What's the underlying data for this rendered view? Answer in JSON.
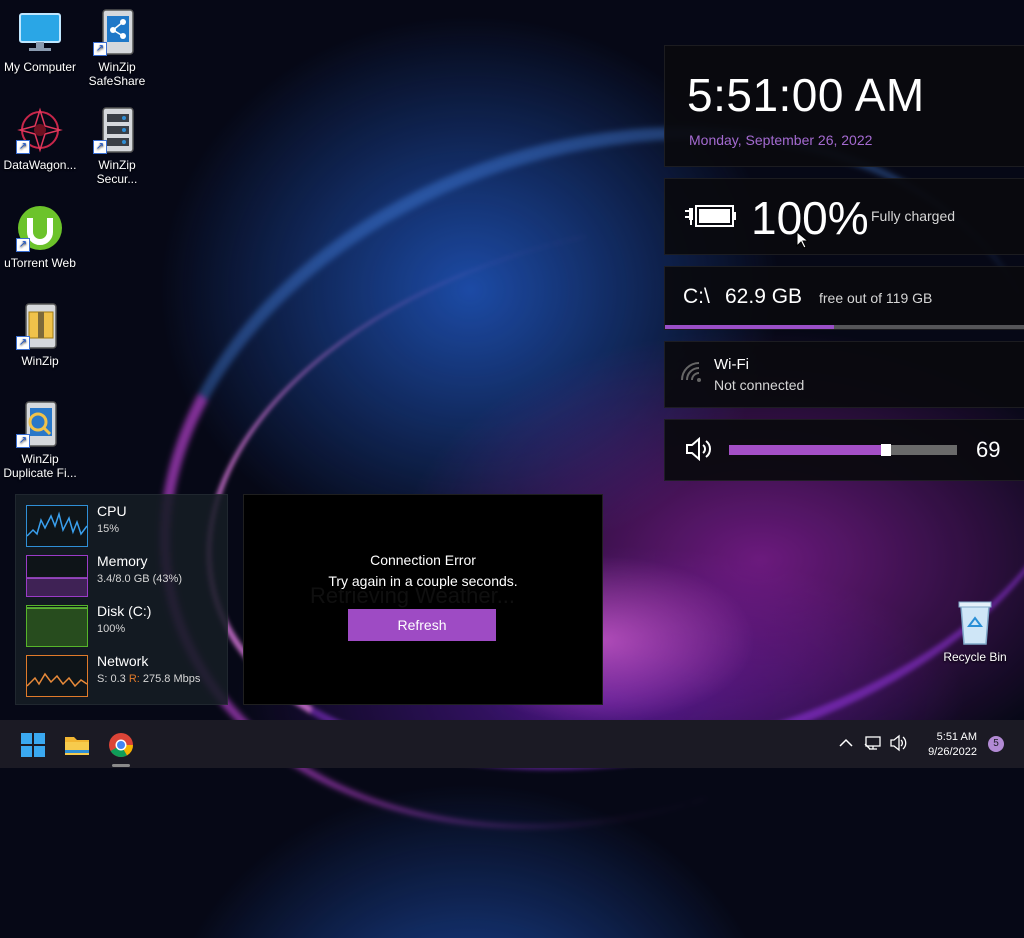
{
  "desktop_icons": {
    "my_computer": "My Computer",
    "safeshare": "WinZip SafeShare",
    "datawagon": "DataWagon...",
    "secure": "WinZip Secur...",
    "utorrent": "uTorrent Web",
    "winzip": "WinZip",
    "duplicate": "WinZip Duplicate Fi...",
    "recycle_bin": "Recycle Bin"
  },
  "clock": {
    "time": "5:51:00 AM",
    "date": "Monday, September 26, 2022"
  },
  "battery": {
    "percent_text": "100%",
    "status": "Fully charged"
  },
  "disk": {
    "drive": "C:\\",
    "free": "62.9 GB",
    "total_text": "free out of 119 GB",
    "used_fraction": 0.47
  },
  "wifi": {
    "name": "Wi-Fi",
    "status": "Not connected"
  },
  "volume": {
    "value": 69
  },
  "performance": {
    "cpu": {
      "name": "CPU",
      "value": "15%",
      "color": "#2f8fd6"
    },
    "memory": {
      "name": "Memory",
      "value": "3.4/8.0 GB (43%)",
      "color": "#9b3bc8"
    },
    "disk": {
      "name": "Disk (C:)",
      "value": "100%",
      "color": "#56b52a"
    },
    "network": {
      "name": "Network",
      "send_label": "S: 0.3",
      "recv_label": "R:",
      "recv_value": "275.8 Mbps",
      "color": "#e07a2a"
    }
  },
  "weather": {
    "ghost_text": "Retrieving Weather...",
    "error_title": "Connection Error",
    "error_message": "Try again in a couple seconds.",
    "refresh_label": "Refresh"
  },
  "taskbar": {
    "time": "5:51 AM",
    "date": "9/26/2022",
    "notification_count": "5",
    "icons": [
      "start-icon",
      "file-explorer-icon",
      "chrome-icon"
    ],
    "tray": [
      "chevron-up-icon",
      "network-icon",
      "volume-icon"
    ]
  },
  "colors": {
    "accent": "#a44fc6",
    "date_text": "#a46ad0"
  }
}
